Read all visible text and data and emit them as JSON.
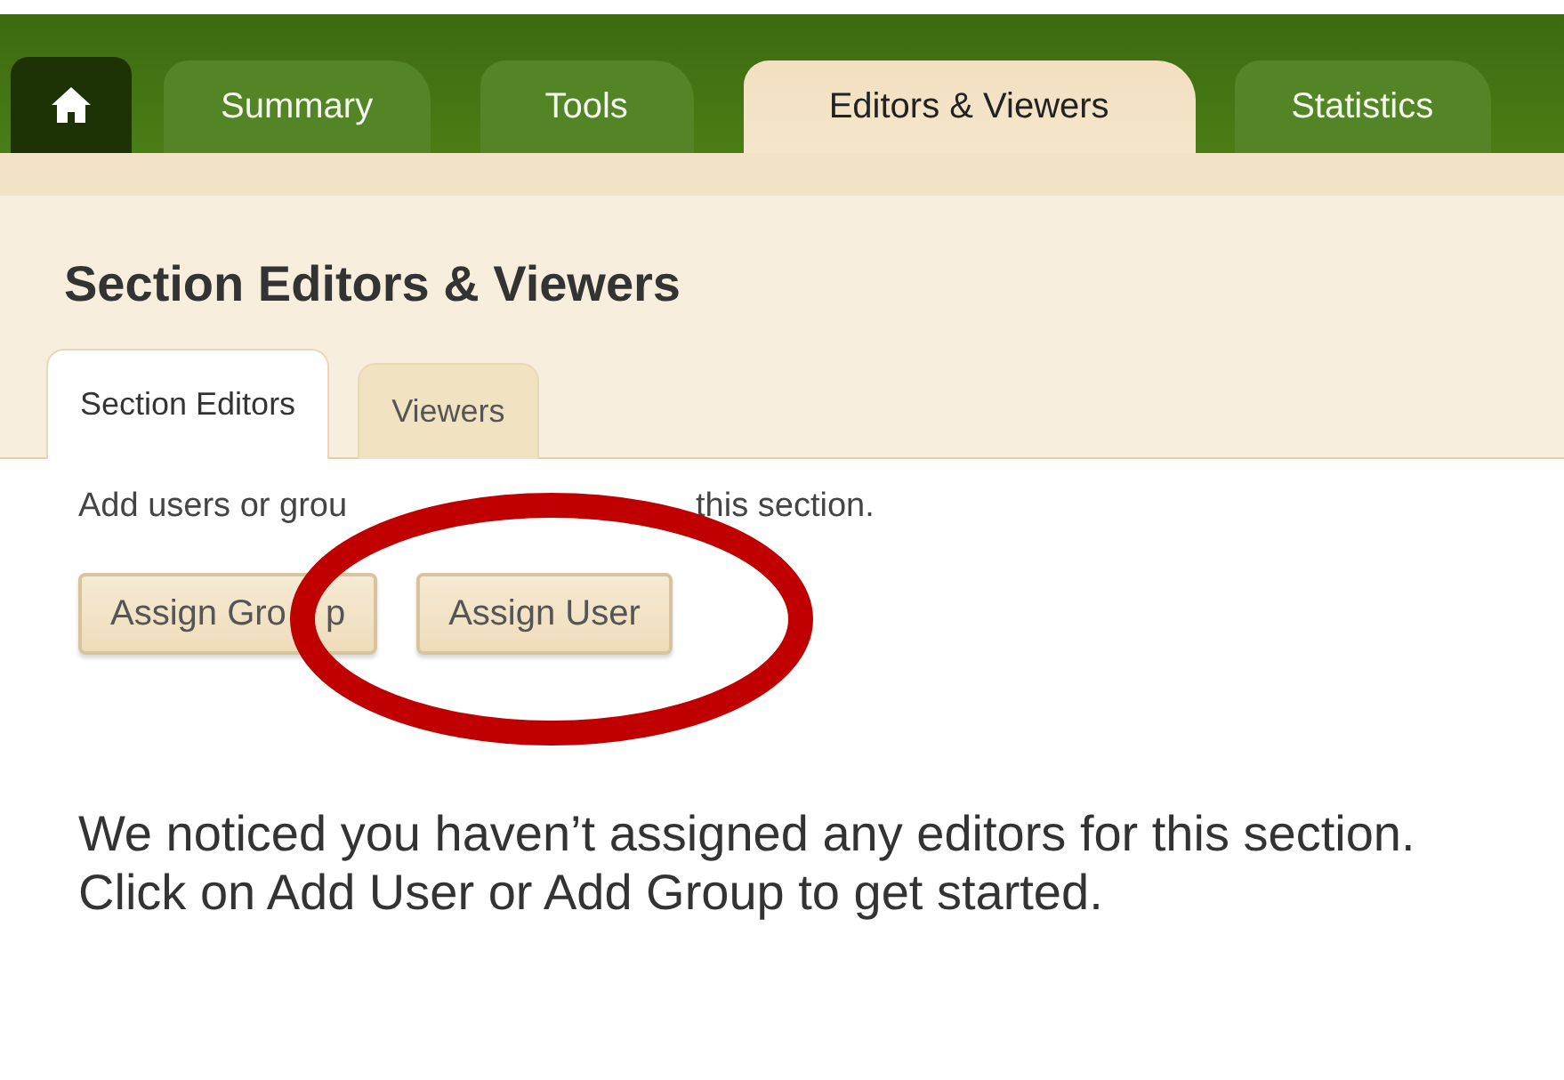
{
  "nav_tabs": [
    {
      "kind": "home",
      "selected": false
    },
    {
      "kind": "text",
      "label": "Summary",
      "selected": false
    },
    {
      "kind": "text",
      "label": "Tools",
      "selected": false
    },
    {
      "kind": "text",
      "label": "Editors & Viewers",
      "selected": true
    },
    {
      "kind": "text",
      "label": "Statistics",
      "selected": false
    }
  ],
  "page_title": "Section Editors & Viewers",
  "sub_tabs": [
    {
      "label": "Section Editors",
      "selected": true
    },
    {
      "label": "Viewers",
      "selected": false
    }
  ],
  "instructions": [
    "Add users or grou",
    "this section."
  ],
  "buttons": [
    {
      "label_parts": [
        "Assign Gro",
        "p"
      ]
    },
    {
      "label_parts": [
        "Assign User"
      ]
    }
  ],
  "empty_message": "We noticed you haven’t assigned any editors for this section. Click on Add User or Add Group to get started.",
  "highlight": {
    "kind": "ellipse",
    "color": "#c00000"
  }
}
